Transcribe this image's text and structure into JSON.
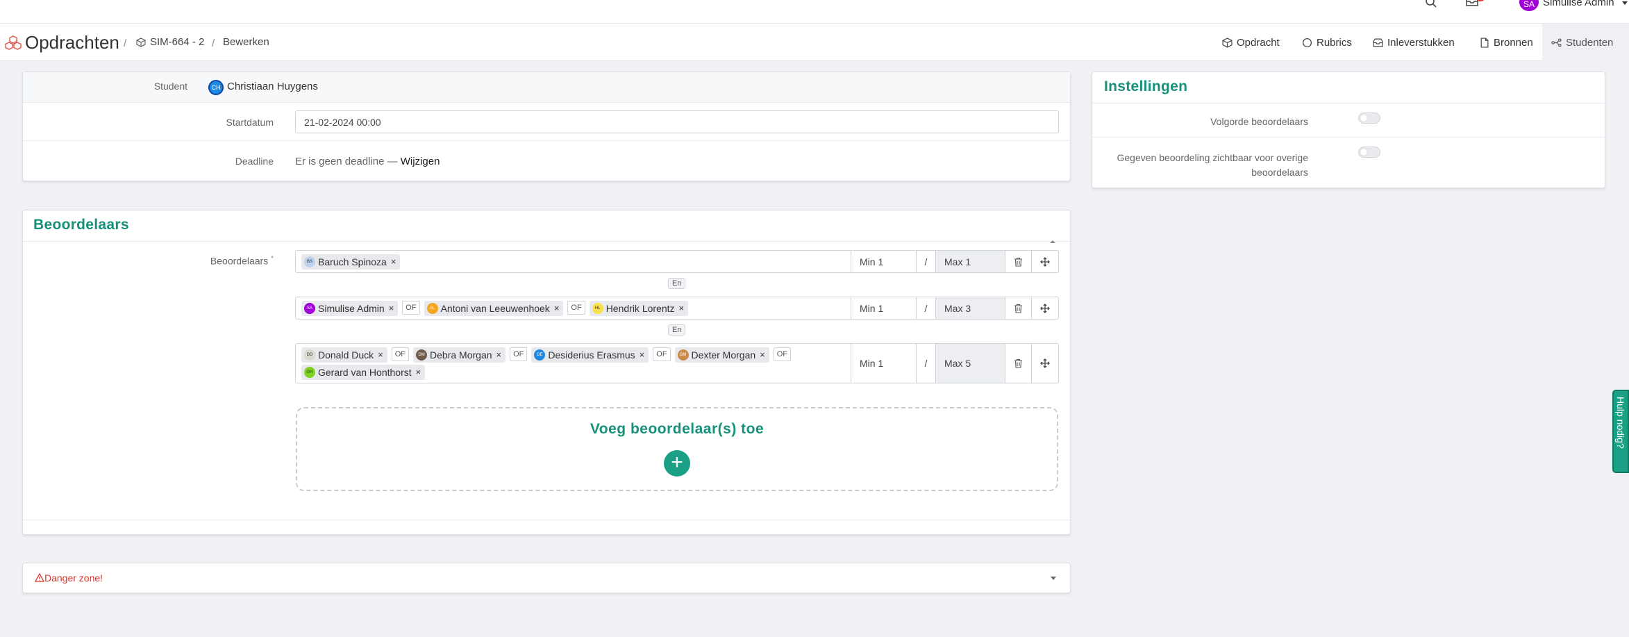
{
  "topbar": {
    "user_initials": "SA",
    "user_name": "Simulise Admin"
  },
  "header": {
    "title": "Opdrachten",
    "breadcrumb": [
      "SIM-664 - 2",
      "Bewerken"
    ],
    "tabs": [
      {
        "label": "Opdracht",
        "icon": "cube-icon"
      },
      {
        "label": "Rubrics",
        "icon": "circle-icon"
      },
      {
        "label": "Inleverstukken",
        "icon": "inbox-icon"
      },
      {
        "label": "Bronnen",
        "icon": "file-icon"
      },
      {
        "label": "Studenten",
        "icon": "share-nodes-icon",
        "active": true
      }
    ]
  },
  "details": {
    "student_label": "Student",
    "student_initials": "CH",
    "student_name": "Christiaan Huygens",
    "startdatum_label": "Startdatum",
    "startdatum_value": "21-02-2024 00:00",
    "deadline_label": "Deadline",
    "deadline_text": "Er is geen deadline — ",
    "deadline_link": "Wijzigen"
  },
  "settings": {
    "title": "Instellingen",
    "volgorde_label": "Volgorde beoordelaars",
    "zichtbaar_label_line1": "Gegeven beoordeling zichtbaar voor overige",
    "zichtbaar_label_line2": "beoordelaars"
  },
  "graders": {
    "title": "Beoordelaars",
    "field_label": "Beoordelaars",
    "required_mark": "*",
    "or_label": "OF",
    "and_label": "En",
    "slash": "/",
    "remove_glyph": "×",
    "groups": [
      {
        "members": [
          {
            "initials": "BS",
            "name": "Baruch Spinoza",
            "color": "#bcd4f0"
          }
        ],
        "min": "Min 1",
        "max": "Max 1"
      },
      {
        "members": [
          {
            "initials": "SA",
            "name": "Simulise Admin",
            "color": "#a100d6"
          },
          {
            "initials": "AL",
            "name": "Antoni van Leeuwenhoek",
            "color": "#f5a623"
          },
          {
            "initials": "HL",
            "name": "Hendrik Lorentz",
            "color": "#f8e14b"
          }
        ],
        "min": "Min 1",
        "max": "Max 3"
      },
      {
        "members": [
          {
            "initials": "DD",
            "name": "Donald Duck",
            "color": "#d8dcd0"
          },
          {
            "initials": "DM",
            "name": "Debra Morgan",
            "color": "#6d5a4a"
          },
          {
            "initials": "DE",
            "name": "Desiderius Erasmus",
            "color": "#1e88e5"
          },
          {
            "initials": "DM",
            "name": "Dexter Morgan",
            "color": "#c98a4a"
          },
          {
            "initials": "GH",
            "name": "Gerard van Honthorst",
            "color": "#7ed321"
          }
        ],
        "min": "Min 1",
        "max": "Max 5"
      }
    ],
    "add_label": "Voeg beoordelaar(s) toe",
    "add_glyph": "+"
  },
  "danger": {
    "label": "Danger zone!"
  },
  "help": {
    "label": "Hulp nodig?"
  },
  "colors": {
    "accent": "#169179",
    "accent_button": "#1aa084",
    "danger": "#d9342b",
    "logo": "#e05a4f"
  }
}
